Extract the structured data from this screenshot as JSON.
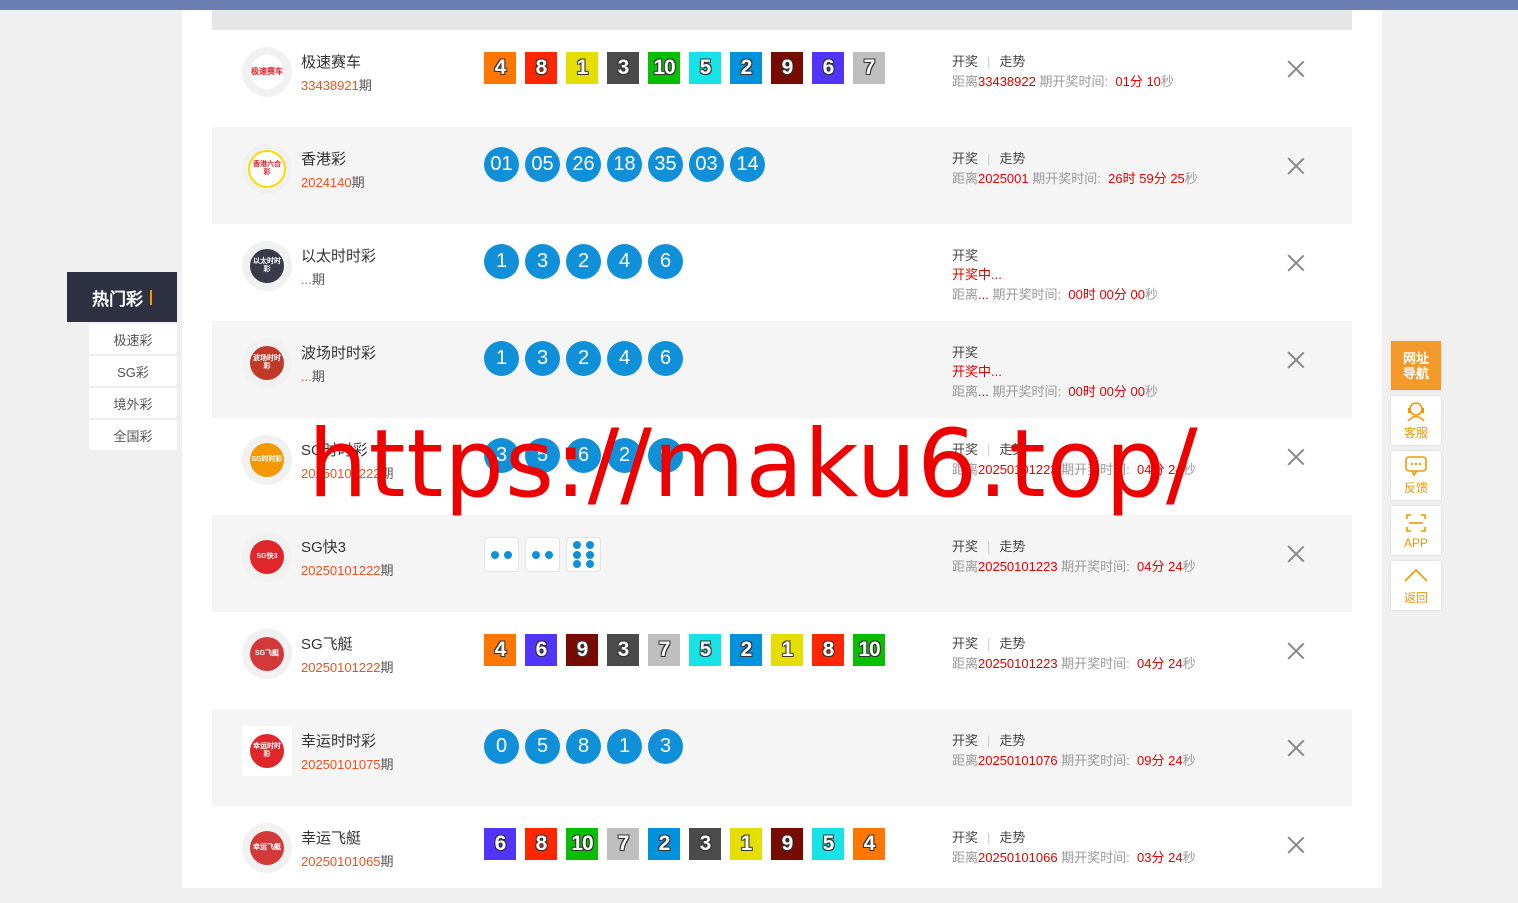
{
  "colors": {
    "accent": "#f39800",
    "issue_red": "#f0501e",
    "countdown_red": "#e30000",
    "ball_blue": "#1090d8",
    "sidebar_dark": "#2e3142",
    "topbar": "#6b7fb2"
  },
  "sidebar": {
    "title": "热门彩",
    "items": [
      {
        "label": "极速彩"
      },
      {
        "label": "SG彩"
      },
      {
        "label": "境外彩"
      },
      {
        "label": "全国彩"
      }
    ]
  },
  "float_panel": {
    "nav_line1": "网址",
    "nav_line2": "导航",
    "service": "客服",
    "feedback": "反馈",
    "app": "APP",
    "back": "返回"
  },
  "common": {
    "draw_label": "开奖",
    "trend_label": "走势",
    "issue_suffix": "期",
    "distance_prefix": "距离",
    "period_time_label": "期开奖时间:",
    "drawing_label": "开奖中..."
  },
  "rows": [
    {
      "name": "极速赛车",
      "issue": "33438921",
      "logo_text": "极速赛车",
      "next": "33438922",
      "time_parts": [
        "01",
        "分 ",
        "10",
        "秒"
      ],
      "balls": [
        "4",
        "8",
        "1",
        "3",
        "10",
        "5",
        "2",
        "9",
        "6",
        "7"
      ]
    },
    {
      "name": "香港彩",
      "issue": "2024140",
      "logo_text": "香港六合彩",
      "next": "2025001",
      "time_parts": [
        "26",
        "时 ",
        "59",
        "分 ",
        "25",
        "秒"
      ],
      "balls": [
        "01",
        "05",
        "26",
        "18",
        "35",
        "03",
        "14"
      ]
    },
    {
      "name": "以太时时彩",
      "issue": "...",
      "logo_text": "以太时时彩",
      "next": "...",
      "time_parts": [
        "00",
        "时 ",
        "00",
        "分 ",
        "00",
        "秒"
      ],
      "balls": [
        "1",
        "3",
        "2",
        "4",
        "6"
      ]
    },
    {
      "name": "波场时时彩",
      "issue": "...",
      "logo_text": "波场时时彩",
      "next": "...",
      "time_parts": [
        "00",
        "时 ",
        "00",
        "分 ",
        "00",
        "秒"
      ],
      "balls": [
        "1",
        "3",
        "2",
        "4",
        "6"
      ]
    },
    {
      "name": "SG时时彩",
      "issue": "20250101222",
      "logo_text": "SG时时彩",
      "next": "20250101223",
      "time_parts": [
        "04",
        "分 ",
        "24",
        "秒"
      ],
      "balls": [
        "3",
        "5",
        "6",
        "2",
        "9"
      ]
    },
    {
      "name": "SG快3",
      "issue": "20250101222",
      "logo_text": "SG快3",
      "next": "20250101223",
      "time_parts": [
        "04",
        "分 ",
        "24",
        "秒"
      ],
      "dice": [
        2,
        2,
        6
      ]
    },
    {
      "name": "SG飞艇",
      "issue": "20250101222",
      "logo_text": "SG飞艇",
      "next": "20250101223",
      "time_parts": [
        "04",
        "分 ",
        "24",
        "秒"
      ],
      "balls": [
        "4",
        "6",
        "9",
        "3",
        "7",
        "5",
        "2",
        "1",
        "8",
        "10"
      ]
    },
    {
      "name": "幸运时时彩",
      "issue": "20250101075",
      "logo_text": "幸运时时彩",
      "next": "20250101076",
      "time_parts": [
        "09",
        "分 ",
        "24",
        "秒"
      ],
      "balls": [
        "0",
        "5",
        "8",
        "1",
        "3"
      ]
    },
    {
      "name": "幸运飞艇",
      "issue": "20250101065",
      "logo_text": "幸运飞艇",
      "next": "20250101066",
      "time_parts": [
        "03",
        "分 ",
        "24",
        "秒"
      ],
      "balls": [
        "6",
        "8",
        "10",
        "7",
        "2",
        "3",
        "1",
        "9",
        "5",
        "4"
      ]
    }
  ],
  "watermark": "https://maku6.top/"
}
